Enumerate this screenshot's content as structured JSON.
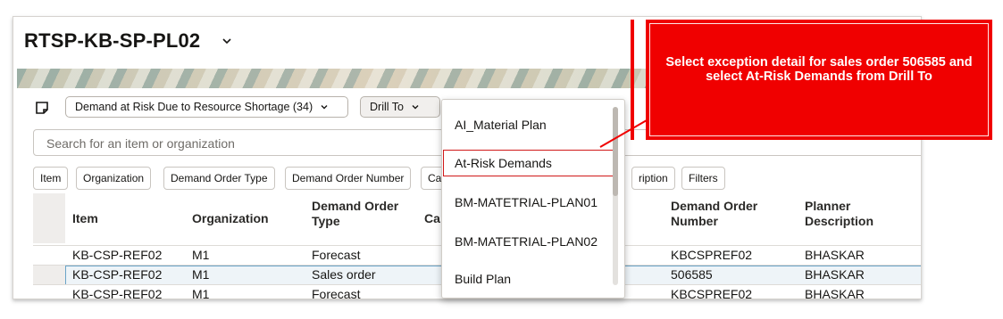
{
  "page": {
    "title": "RTSP-KB-SP-PL02",
    "exception_selector": "Demand at Risk Due to Resource Shortage (34)",
    "drill_to_label": "Drill To",
    "search_placeholder": "Search for an item or organization"
  },
  "filters": [
    "Item",
    "Organization",
    "Demand Order Type",
    "Demand Order Number",
    "Ca",
    "ription",
    "Filters"
  ],
  "table": {
    "headers": {
      "item": "Item",
      "organization": "Organization",
      "demand_order_type": "Demand Order Type",
      "ca": "Ca",
      "demand_order_number": "Demand Order Number",
      "planner_description": "Planner Description"
    },
    "rows": [
      {
        "item": "KB-CSP-REF02",
        "organization": "M1",
        "type": "Forecast",
        "number": "KBCSPREF02",
        "planner": "BHASKAR"
      },
      {
        "item": "KB-CSP-REF02",
        "organization": "M1",
        "type": "Sales order",
        "number": "506585",
        "planner": "BHASKAR"
      },
      {
        "item": "KB-CSP-REF02",
        "organization": "M1",
        "type": "Forecast",
        "number": "KBCSPREF02",
        "planner": "BHASKAR"
      }
    ]
  },
  "dropdown": {
    "items": [
      "AI_Material Plan",
      "At-Risk Demands",
      "BM-MATETRIAL-PLAN01",
      "BM-MATETRIAL-PLAN02",
      "Build Plan"
    ],
    "highlighted": "At-Risk Demands"
  },
  "callout": {
    "text": "Select exception detail for sales order 506585 and select At-Risk Demands from Drill To",
    "color": "#f00000"
  },
  "icons": [
    "chevron-down-icon",
    "note-icon"
  ]
}
